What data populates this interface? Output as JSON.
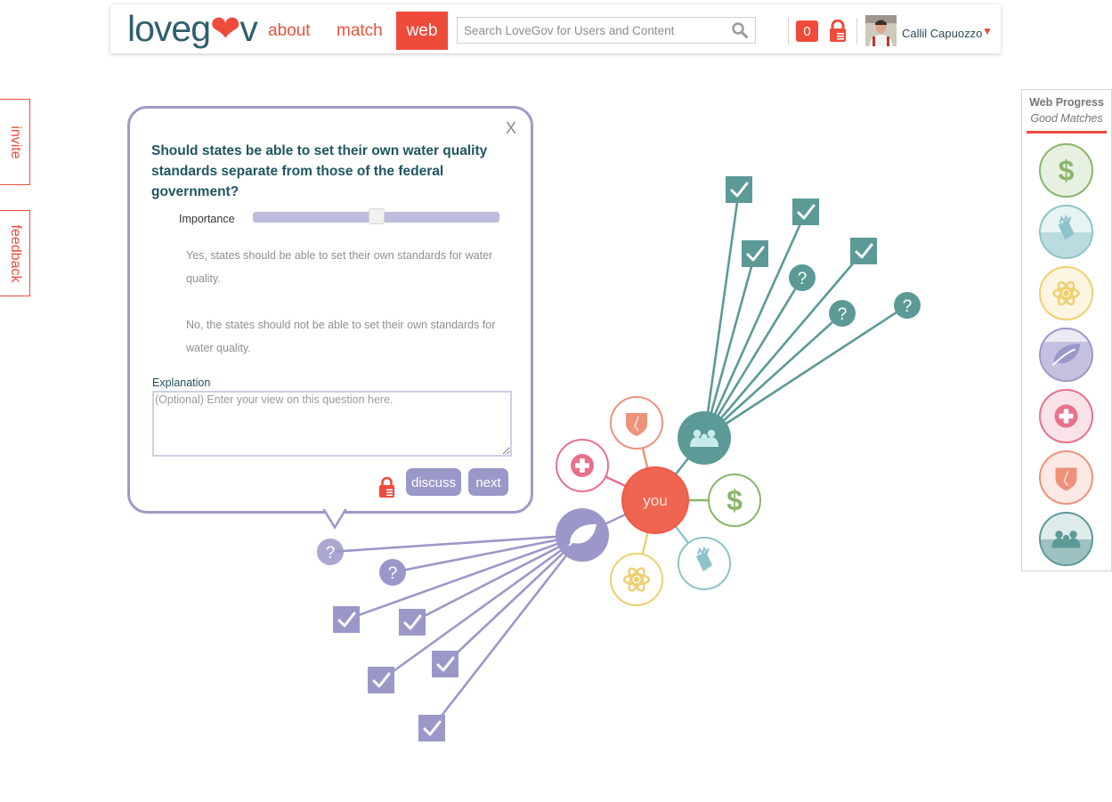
{
  "header": {
    "logo": {
      "pre": "loveg",
      "post": "v"
    },
    "nav": {
      "about": "about",
      "match": "match",
      "web": "web"
    },
    "search_placeholder": "Search LoveGov for Users and Content",
    "notification_count": "0",
    "user_name": "Callil Capuozzo",
    "user_menu_caret": "▼"
  },
  "side_tabs": {
    "invite": "invite",
    "feedback": "feedback"
  },
  "progress_panel": {
    "title": "Web Progress",
    "subtitle": "Good Matches",
    "topics": [
      {
        "icon": "dollar-icon",
        "color": "#8ab56a",
        "fill_fraction": 0.0
      },
      {
        "icon": "education-icon",
        "color": "#8cc4c9",
        "fill_fraction": 0.5
      },
      {
        "icon": "science-icon",
        "color": "#f0cf6e",
        "fill_fraction": 0.0
      },
      {
        "icon": "environment-icon",
        "color": "#9b98c9",
        "fill_fraction": 0.75
      },
      {
        "icon": "health-icon",
        "color": "#e8718b",
        "fill_fraction": 0.0
      },
      {
        "icon": "security-icon",
        "color": "#ee927c",
        "fill_fraction": 0.0
      },
      {
        "icon": "family-icon",
        "color": "#5c9a97",
        "fill_fraction": 0.5
      }
    ]
  },
  "web_graph": {
    "center_label": "you",
    "topic_nodes": [
      {
        "icon": "family-icon",
        "color": "#5c9a97",
        "expanded": true
      },
      {
        "icon": "dollar-icon",
        "color": "#8ab56a",
        "expanded": false
      },
      {
        "icon": "education-icon",
        "color": "#8cc4c9",
        "expanded": false
      },
      {
        "icon": "science-icon",
        "color": "#f0cf6e",
        "expanded": false
      },
      {
        "icon": "environment-icon",
        "color": "#9b98c9",
        "expanded": true
      },
      {
        "icon": "health-icon",
        "color": "#e8718b",
        "expanded": false
      },
      {
        "icon": "security-icon",
        "color": "#ee927c",
        "expanded": false
      }
    ],
    "family_questions": [
      "answered",
      "answered",
      "answered",
      "unanswered",
      "answered",
      "unanswered",
      "unanswered"
    ],
    "environment_questions": [
      "unanswered-active",
      "unanswered",
      "answered",
      "answered",
      "answered",
      "answered",
      "answered"
    ],
    "question_mark": "?"
  },
  "popup": {
    "close": "X",
    "question": "Should states be able to set their own water quality standards separate from those of the federal government?",
    "importance_label": "Importance",
    "importance_value": 0.5,
    "answers": [
      "Yes, states should be able to set their own standards for water quality.",
      "No, the states should not be able to set their own standards for water quality."
    ],
    "explanation_label": "Explanation",
    "explanation_placeholder": "(Optional) Enter your view on this question here.",
    "discuss": "discuss",
    "next": "next"
  }
}
